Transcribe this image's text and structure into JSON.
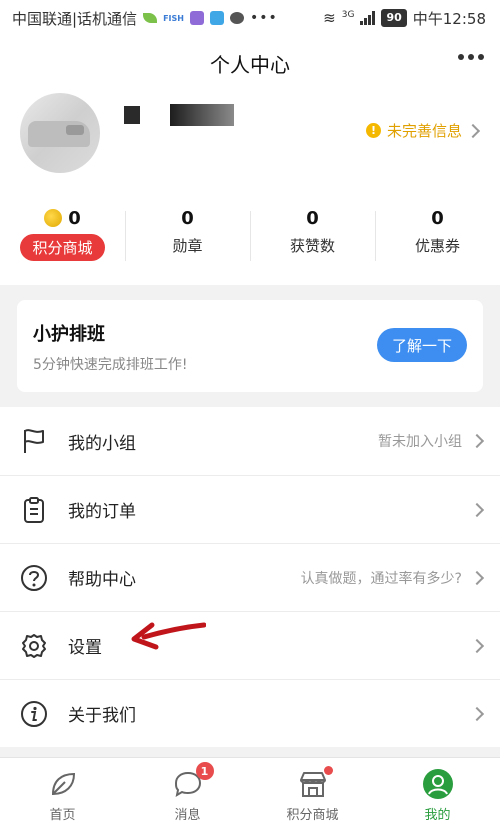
{
  "status_bar": {
    "carrier": "中国联通|话机通信",
    "fish_label": "FISH",
    "network": "3G",
    "battery": "90",
    "time": "中午12:58"
  },
  "header": {
    "title": "个人中心"
  },
  "profile": {
    "incomplete_label": "未完善信息"
  },
  "stats": [
    {
      "value": "0",
      "label": "积分商城"
    },
    {
      "value": "0",
      "label": "勋章"
    },
    {
      "value": "0",
      "label": "获赞数"
    },
    {
      "value": "0",
      "label": "优惠券"
    }
  ],
  "banner": {
    "title": "小护排班",
    "subtitle": "5分钟快速完成排班工作!",
    "button": "了解一下"
  },
  "menu": [
    {
      "label": "我的小组",
      "right": "暂未加入小组",
      "icon": "flag-icon"
    },
    {
      "label": "我的订单",
      "right": "",
      "icon": "clipboard-icon"
    },
    {
      "label": "帮助中心",
      "right": "认真做题，通过率有多少?",
      "icon": "help-icon"
    },
    {
      "label": "设置",
      "right": "",
      "icon": "gear-icon"
    },
    {
      "label": "关于我们",
      "right": "",
      "icon": "info-icon"
    }
  ],
  "bottom_nav": [
    {
      "label": "首页",
      "icon": "leaf-icon"
    },
    {
      "label": "消息",
      "icon": "chat-icon",
      "badge": "1"
    },
    {
      "label": "积分商城",
      "icon": "store-icon"
    },
    {
      "label": "我的",
      "icon": "user-icon"
    }
  ],
  "colors": {
    "accent_green": "#2a9d3e",
    "points_red": "#e83a3a",
    "button_blue": "#3d8ef0",
    "warning_yellow": "#f5b800",
    "annotation_red": "#c0161b"
  }
}
